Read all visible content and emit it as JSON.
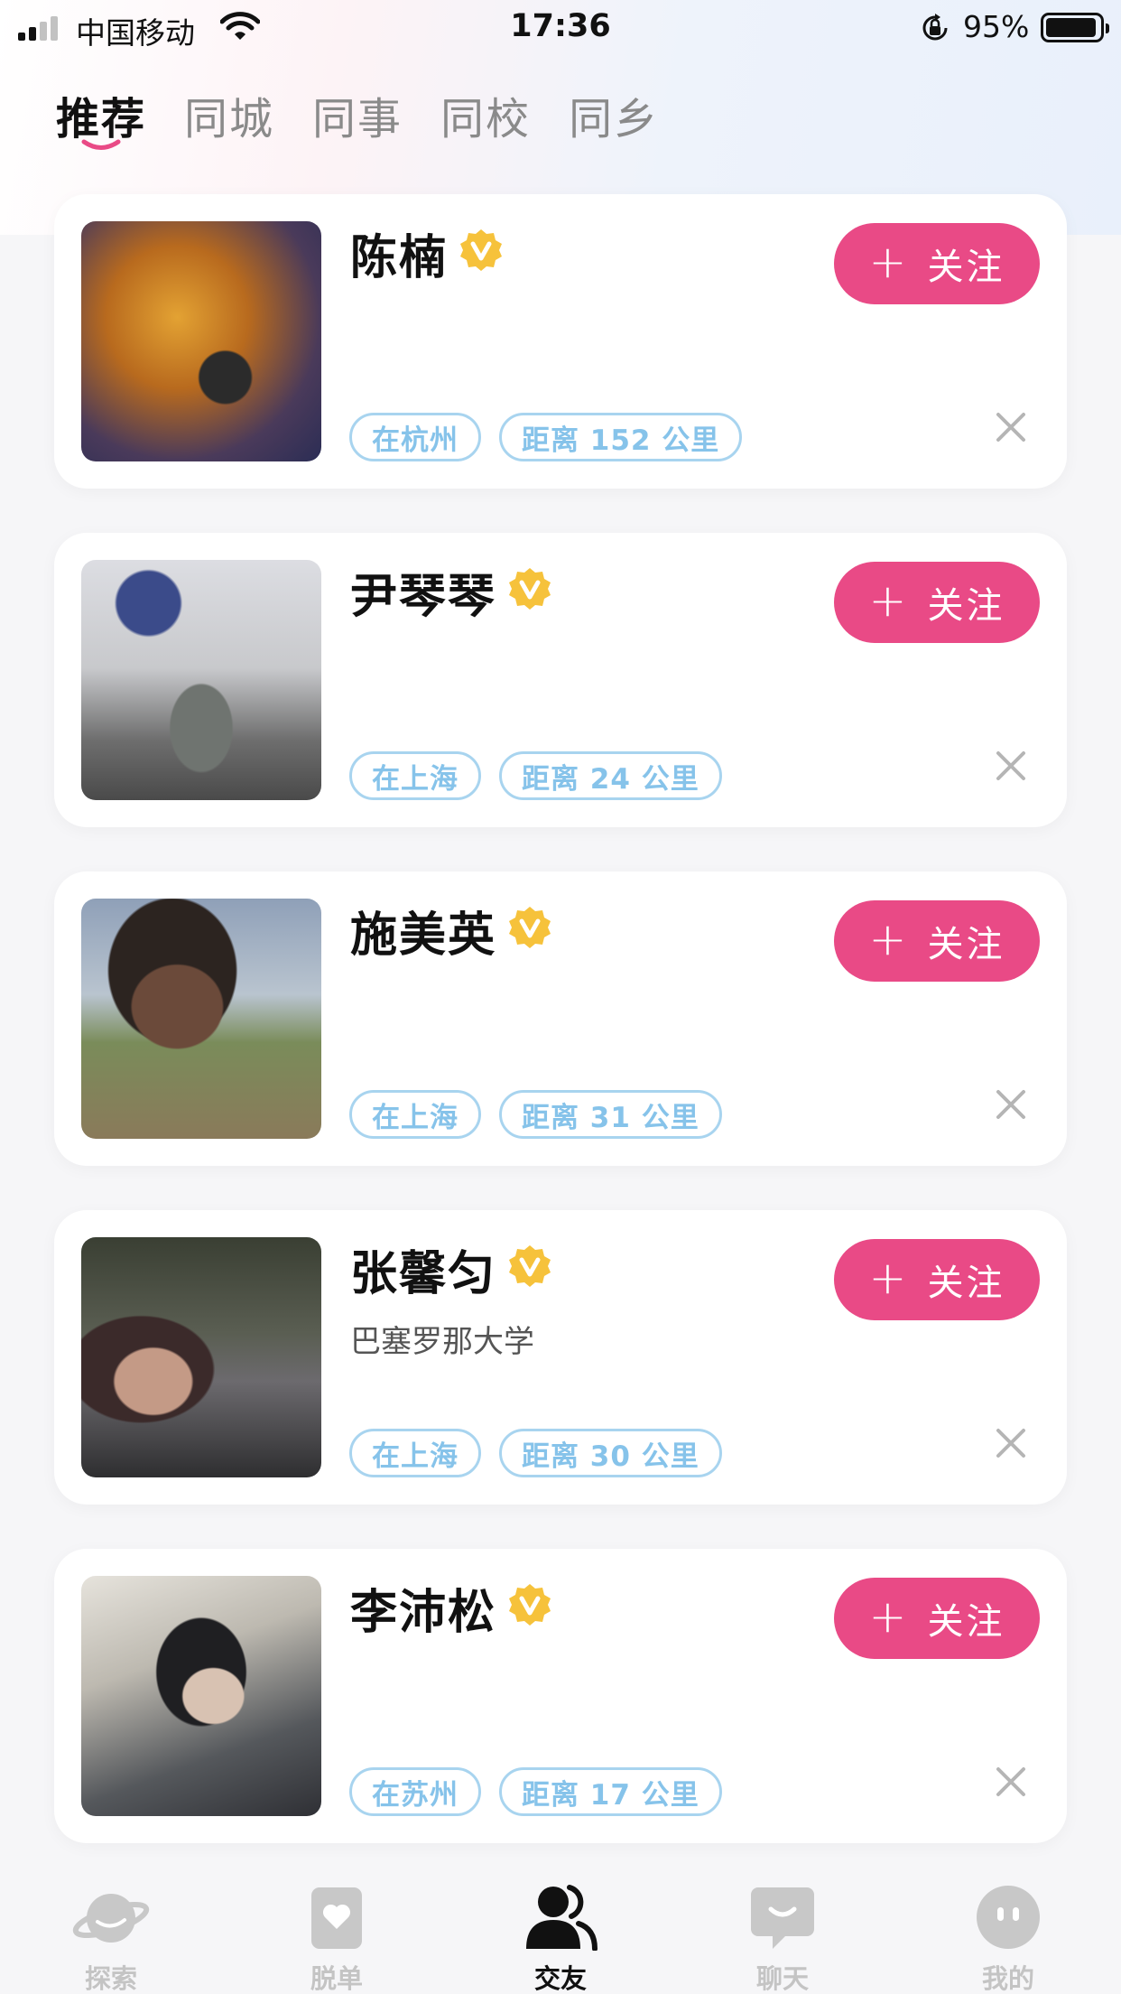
{
  "status_bar": {
    "carrier": "中国移动",
    "time": "17:36",
    "battery": "95%",
    "battery_level": 0.95,
    "signal_bars": 2
  },
  "tabs": [
    {
      "label": "推荐",
      "active": true
    },
    {
      "label": "同城",
      "active": false
    },
    {
      "label": "同事",
      "active": false
    },
    {
      "label": "同校",
      "active": false
    },
    {
      "label": "同乡",
      "active": false
    }
  ],
  "follow_label": "关注",
  "accent_color": "#e94a86",
  "chip_color": "#86c3ea",
  "verified_color": "#f6c23b",
  "profiles": [
    {
      "name": "陈楠",
      "subtitle": "",
      "location": "在杭州",
      "distance": "距离 152 公里",
      "avatar_icon": "cave-photo"
    },
    {
      "name": "尹琴琴",
      "subtitle": "",
      "location": "在上海",
      "distance": "距离 24 公里",
      "avatar_icon": "city-sculpture-photo"
    },
    {
      "name": "施美英",
      "subtitle": "",
      "location": "在上海",
      "distance": "距离 31 公里",
      "avatar_icon": "grassland-sky-photo"
    },
    {
      "name": "张馨匀",
      "subtitle": "巴塞罗那大学",
      "location": "在上海",
      "distance": "距离 30 公里",
      "avatar_icon": "night-terrace-photo"
    },
    {
      "name": "李沛松",
      "subtitle": "",
      "location": "在苏州",
      "distance": "距离 17 公里",
      "avatar_icon": "indoor-portrait-photo"
    }
  ],
  "bottom_nav": [
    {
      "label": "探索",
      "icon": "planet-icon",
      "active": false
    },
    {
      "label": "脱单",
      "icon": "heart-card-icon",
      "active": false
    },
    {
      "label": "交友",
      "icon": "friends-icon",
      "active": true
    },
    {
      "label": "聊天",
      "icon": "chat-bubble-icon",
      "active": false
    },
    {
      "label": "我的",
      "icon": "face-icon",
      "active": false
    }
  ]
}
